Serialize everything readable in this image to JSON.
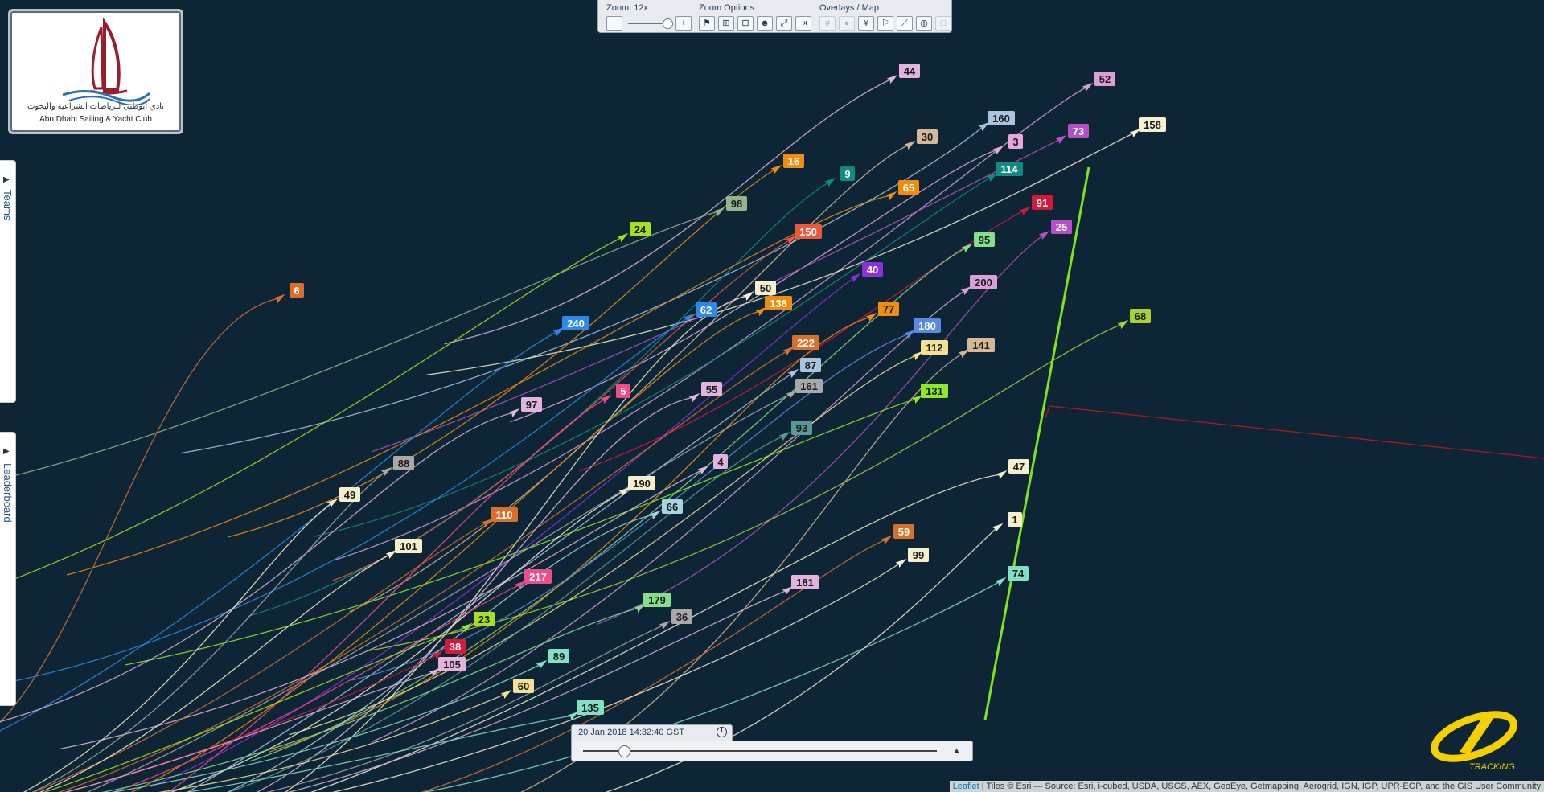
{
  "club": {
    "name_arabic": "نادي أبوظبي للرياضات الشراعية واليخوت",
    "name_english": "Abu Dhabi Sailing & Yacht Club"
  },
  "toolbar": {
    "zoom_label": "Zoom:",
    "zoom_value": "12x",
    "zoom_options_label": "Zoom Options",
    "overlays_label": "Overlays / Map",
    "zoom_out_icon": "minus-icon",
    "zoom_in_icon": "plus-icon"
  },
  "side_tabs": {
    "teams": "Teams",
    "leaderboard": "Leaderboard"
  },
  "timeline": {
    "datetime": "20 Jan 2018 14:32:40 GST",
    "position_fraction": 0.1
  },
  "attribution": {
    "leaflet": "Leaflet",
    "tiles": "| Tiles © Esri — Source: Esri, i-cubed, USDA, USGS, AEX, GeoEye, Getmapping, Aerogrid, IGN, IGP, UPR-EGP, and the GIS User Community"
  },
  "brand": {
    "tracking": "TRACKING"
  },
  "colors": {
    "sea": "#0d2535",
    "finish_line": "#7fe41d",
    "course_line": "#b01818"
  },
  "boats": [
    {
      "id": "44",
      "color": "#e0b4dc"
    },
    {
      "id": "52",
      "color": "#d8a0d6"
    },
    {
      "id": "160",
      "color": "#aac4e0"
    },
    {
      "id": "158",
      "color": "#f4efcc"
    },
    {
      "id": "3",
      "color": "#e6a8dc"
    },
    {
      "id": "73",
      "color": "#b550c4"
    },
    {
      "id": "30",
      "color": "#d6b896"
    },
    {
      "id": "16",
      "color": "#f08c10"
    },
    {
      "id": "9",
      "color": "#128a82"
    },
    {
      "id": "114",
      "color": "#128a82"
    },
    {
      "id": "65",
      "color": "#f08c10"
    },
    {
      "id": "98",
      "color": "#94b48c"
    },
    {
      "id": "91",
      "color": "#d6183a"
    },
    {
      "id": "25",
      "color": "#b550c4"
    },
    {
      "id": "24",
      "color": "#a8e01e"
    },
    {
      "id": "150",
      "color": "#e85a3c"
    },
    {
      "id": "95",
      "color": "#82e08c"
    },
    {
      "id": "40",
      "color": "#8c30d8"
    },
    {
      "id": "200",
      "color": "#d8a0d6"
    },
    {
      "id": "6",
      "color": "#d8702a"
    },
    {
      "id": "50",
      "color": "#f4efcc"
    },
    {
      "id": "77",
      "color": "#f08c10"
    },
    {
      "id": "136",
      "color": "#f08c10"
    },
    {
      "id": "68",
      "color": "#a8d232"
    },
    {
      "id": "240",
      "color": "#2a8ae8"
    },
    {
      "id": "62",
      "color": "#2a8ae8"
    },
    {
      "id": "180",
      "color": "#5a8ae0"
    },
    {
      "id": "222",
      "color": "#d8702a"
    },
    {
      "id": "112",
      "color": "#f4e196"
    },
    {
      "id": "141",
      "color": "#d6b896"
    },
    {
      "id": "87",
      "color": "#aac4e0"
    },
    {
      "id": "161",
      "color": "#a8a8a8"
    },
    {
      "id": "131",
      "color": "#8ee82a"
    },
    {
      "id": "5",
      "color": "#ee4c8a"
    },
    {
      "id": "55",
      "color": "#e0b4dc"
    },
    {
      "id": "97",
      "color": "#e0b4dc"
    },
    {
      "id": "93",
      "color": "#5a9a96"
    },
    {
      "id": "88",
      "color": "#a8a8a8"
    },
    {
      "id": "4",
      "color": "#e0b4dc"
    },
    {
      "id": "47",
      "color": "#f4efcc"
    },
    {
      "id": "49",
      "color": "#f4efcc"
    },
    {
      "id": "190",
      "color": "#f4efcc"
    },
    {
      "id": "66",
      "color": "#a8d4e0"
    },
    {
      "id": "1",
      "color": "#f4efcc"
    },
    {
      "id": "110",
      "color": "#d8702a"
    },
    {
      "id": "101",
      "color": "#f4efcc"
    },
    {
      "id": "59",
      "color": "#d8702a"
    },
    {
      "id": "99",
      "color": "#f4efcc"
    },
    {
      "id": "74",
      "color": "#82e0c4"
    },
    {
      "id": "217",
      "color": "#ee4c8a"
    },
    {
      "id": "181",
      "color": "#e0b4dc"
    },
    {
      "id": "179",
      "color": "#82e08c"
    },
    {
      "id": "36",
      "color": "#a8a8a8"
    },
    {
      "id": "23",
      "color": "#a8e01e"
    },
    {
      "id": "38",
      "color": "#d6183a"
    },
    {
      "id": "89",
      "color": "#82e0c4"
    },
    {
      "id": "105",
      "color": "#e0b4dc"
    },
    {
      "id": "60",
      "color": "#f4e196"
    },
    {
      "id": "135",
      "color": "#82e0c4"
    }
  ]
}
